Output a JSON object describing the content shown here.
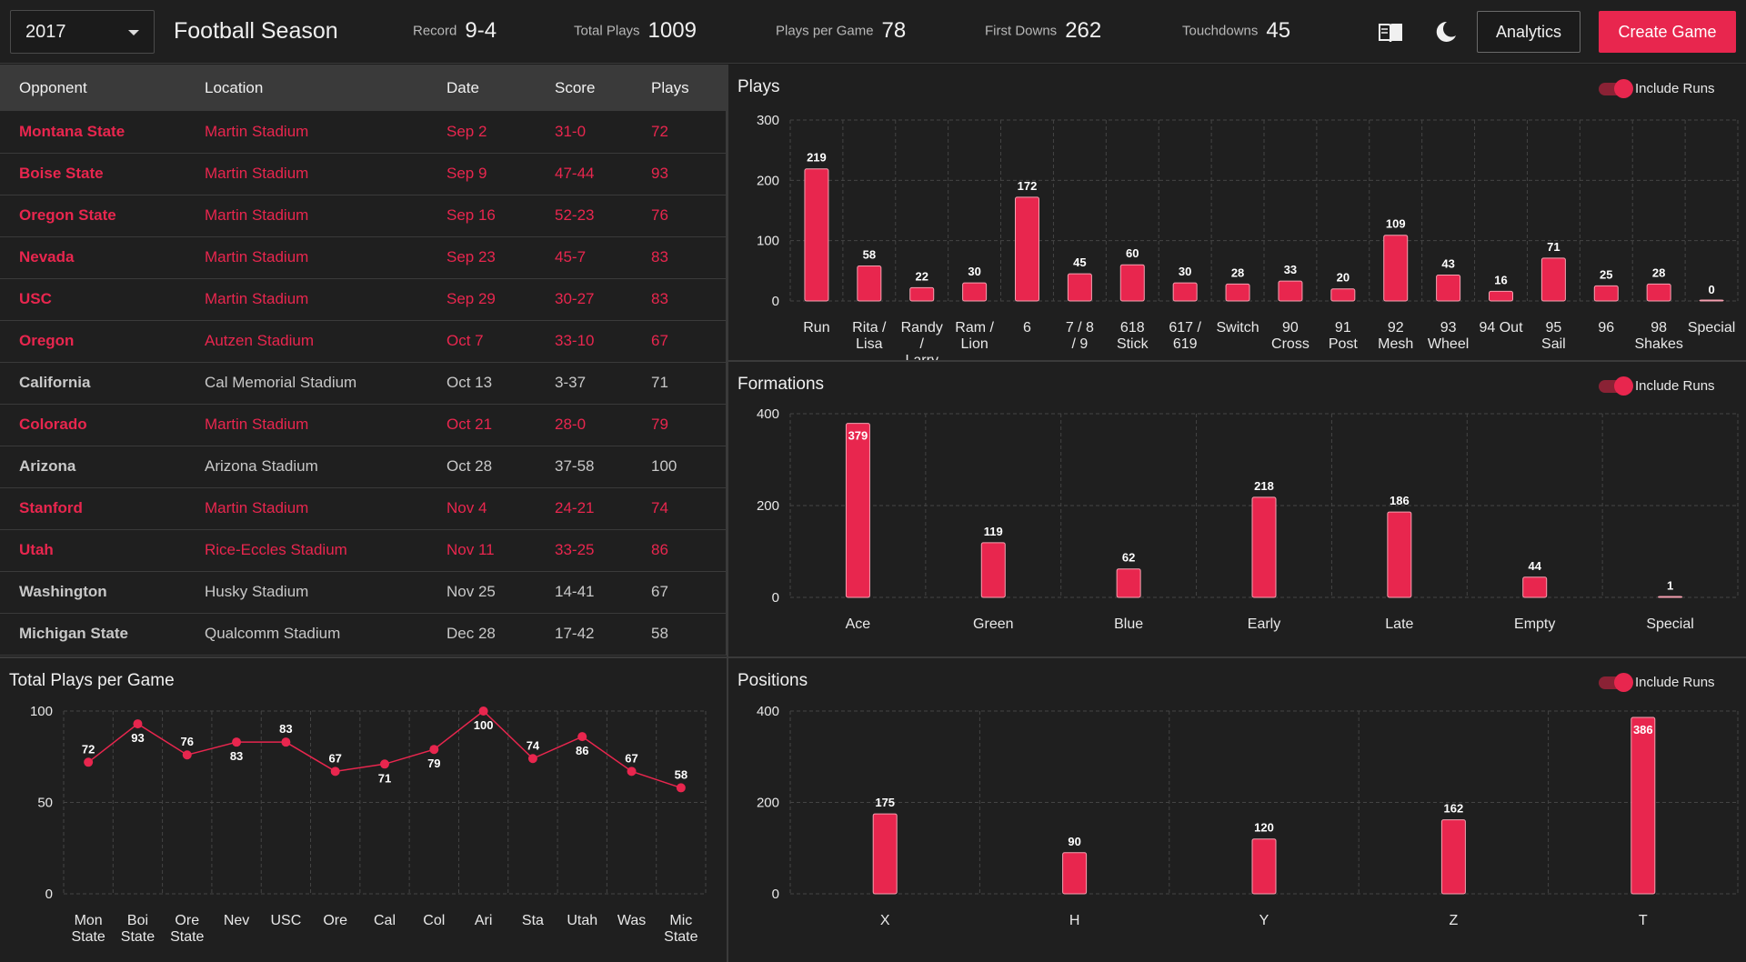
{
  "header": {
    "year": "2017",
    "title": "Football Season",
    "stats": [
      {
        "label": "Record",
        "value": "9-4"
      },
      {
        "label": "Total Plays",
        "value": "1009"
      },
      {
        "label": "Plays per Game",
        "value": "78"
      },
      {
        "label": "First Downs",
        "value": "262"
      },
      {
        "label": "Touchdowns",
        "value": "45"
      }
    ],
    "analytics_label": "Analytics",
    "create_label": "Create Game"
  },
  "colors": {
    "accent": "#e8264e",
    "background": "#1b1b1b",
    "panel": "#1f1f1f",
    "muted_text": "#c8c8c8"
  },
  "icons": {
    "guide": "book-icon",
    "theme": "moon-icon",
    "dropdown": "chevron-down-icon"
  },
  "table": {
    "headers": {
      "opponent": "Opponent",
      "location": "Location",
      "date": "Date",
      "score": "Score",
      "plays": "Plays"
    },
    "rows": [
      {
        "opponent": "Montana State",
        "location": "Martin Stadium",
        "date": "Sep 2",
        "score": "31-0",
        "plays": "72",
        "result": "win"
      },
      {
        "opponent": "Boise State",
        "location": "Martin Stadium",
        "date": "Sep 9",
        "score": "47-44",
        "plays": "93",
        "result": "win"
      },
      {
        "opponent": "Oregon State",
        "location": "Martin Stadium",
        "date": "Sep 16",
        "score": "52-23",
        "plays": "76",
        "result": "win"
      },
      {
        "opponent": "Nevada",
        "location": "Martin Stadium",
        "date": "Sep 23",
        "score": "45-7",
        "plays": "83",
        "result": "win"
      },
      {
        "opponent": "USC",
        "location": "Martin Stadium",
        "date": "Sep 29",
        "score": "30-27",
        "plays": "83",
        "result": "win"
      },
      {
        "opponent": "Oregon",
        "location": "Autzen Stadium",
        "date": "Oct 7",
        "score": "33-10",
        "plays": "67",
        "result": "win"
      },
      {
        "opponent": "California",
        "location": "Cal Memorial Stadium",
        "date": "Oct 13",
        "score": "3-37",
        "plays": "71",
        "result": "loss"
      },
      {
        "opponent": "Colorado",
        "location": "Martin Stadium",
        "date": "Oct 21",
        "score": "28-0",
        "plays": "79",
        "result": "win"
      },
      {
        "opponent": "Arizona",
        "location": "Arizona Stadium",
        "date": "Oct 28",
        "score": "37-58",
        "plays": "100",
        "result": "loss"
      },
      {
        "opponent": "Stanford",
        "location": "Martin Stadium",
        "date": "Nov 4",
        "score": "24-21",
        "plays": "74",
        "result": "win"
      },
      {
        "opponent": "Utah",
        "location": "Rice-Eccles Stadium",
        "date": "Nov 11",
        "score": "33-25",
        "plays": "86",
        "result": "win"
      },
      {
        "opponent": "Washington",
        "location": "Husky Stadium",
        "date": "Nov 25",
        "score": "14-41",
        "plays": "67",
        "result": "loss"
      },
      {
        "opponent": "Michigan State",
        "location": "Qualcomm Stadium",
        "date": "Dec 28",
        "score": "17-42",
        "plays": "58",
        "result": "loss"
      }
    ]
  },
  "panels": {
    "plays": {
      "title": "Plays",
      "toggle_label": "Include Runs"
    },
    "formations": {
      "title": "Formations",
      "toggle_label": "Include Runs"
    },
    "positions": {
      "title": "Positions",
      "toggle_label": "Include Runs"
    },
    "total_plays": {
      "title": "Total Plays per Game"
    }
  },
  "chart_data": [
    {
      "id": "plays",
      "type": "bar",
      "title": "Plays",
      "categories": [
        "Run",
        "Rita / Lisa",
        "Randy / Larry",
        "Ram / Lion",
        "6",
        "7 / 8 / 9",
        "618 Stick",
        "617 / 619",
        "Switch",
        "90 Cross",
        "91 Post",
        "92 Mesh",
        "93 Wheel",
        "94 Out",
        "95 Sail",
        "96",
        "98 Shakes",
        "Special"
      ],
      "values": [
        219,
        58,
        22,
        30,
        172,
        45,
        60,
        30,
        28,
        33,
        20,
        109,
        43,
        16,
        71,
        25,
        28,
        0
      ],
      "ylim": [
        0,
        300
      ],
      "yticks": [
        0,
        100,
        200,
        300
      ],
      "grid": true
    },
    {
      "id": "formations",
      "type": "bar",
      "title": "Formations",
      "categories": [
        "Ace",
        "Green",
        "Blue",
        "Early",
        "Late",
        "Empty",
        "Special"
      ],
      "values": [
        379,
        119,
        62,
        218,
        186,
        44,
        1
      ],
      "ylim": [
        0,
        400
      ],
      "yticks": [
        0,
        200,
        400
      ],
      "grid": true
    },
    {
      "id": "positions",
      "type": "bar",
      "title": "Positions",
      "categories": [
        "X",
        "H",
        "Y",
        "Z",
        "T"
      ],
      "values": [
        175,
        90,
        120,
        162,
        386
      ],
      "ylim": [
        0,
        400
      ],
      "yticks": [
        0,
        200,
        400
      ],
      "grid": true
    },
    {
      "id": "total_plays",
      "type": "line",
      "title": "Total Plays per Game",
      "categories": [
        "Mon State",
        "Boi State",
        "Ore State",
        "Nev",
        "USC",
        "Ore",
        "Cal",
        "Col",
        "Ari",
        "Sta",
        "Utah",
        "Was",
        "Mic State"
      ],
      "values": [
        72,
        93,
        76,
        83,
        83,
        67,
        71,
        79,
        100,
        74,
        86,
        67,
        58
      ],
      "ylim": [
        0,
        100
      ],
      "yticks": [
        0,
        50,
        100
      ],
      "grid": true
    }
  ]
}
